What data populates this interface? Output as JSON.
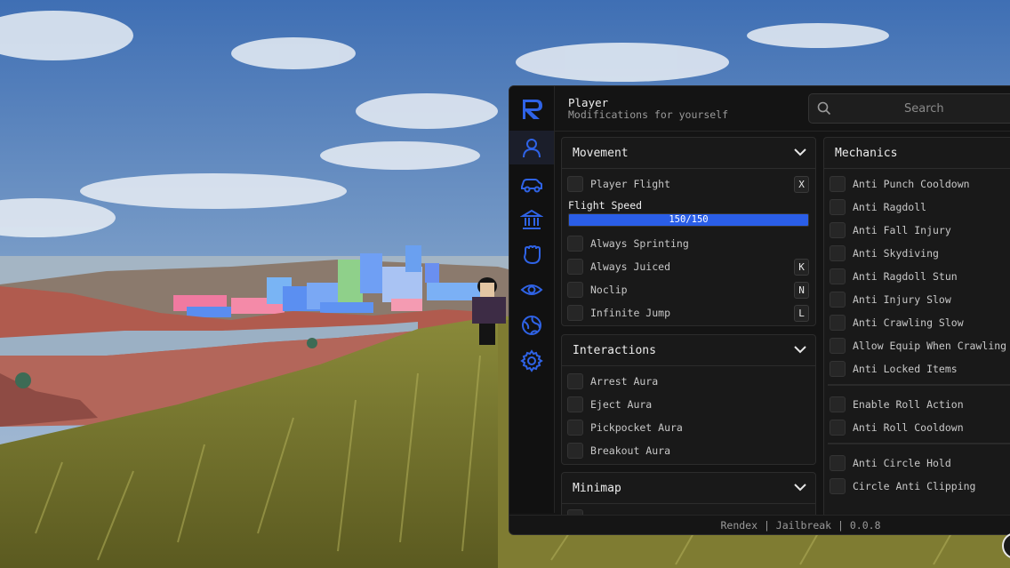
{
  "header": {
    "title": "Player",
    "subtitle": "Modifications for yourself"
  },
  "search": {
    "placeholder": "Search"
  },
  "sidebar": {
    "icons": [
      "logo-icon",
      "player-icon",
      "vehicle-icon",
      "bank-icon",
      "fist-icon",
      "eye-icon",
      "globe-icon",
      "gear-icon"
    ],
    "accent": "#2f63e6"
  },
  "movement": {
    "title": "Movement",
    "flight": {
      "label": "Player Flight",
      "key": "X"
    },
    "speed": {
      "label": "Flight Speed",
      "value": "150/150",
      "fraction": 1.0
    },
    "sprinting": {
      "label": "Always Sprinting"
    },
    "juiced": {
      "label": "Always Juiced",
      "key": "K"
    },
    "noclip": {
      "label": "Noclip",
      "key": "N"
    },
    "jump": {
      "label": "Infinite Jump",
      "key": "L"
    }
  },
  "interactions": {
    "title": "Interactions",
    "items": [
      "Arrest Aura",
      "Eject Aura",
      "Pickpocket Aura",
      "Breakout Aura"
    ]
  },
  "minimap": {
    "title": "Minimap"
  },
  "mechanics": {
    "title": "Mechanics",
    "group1": [
      "Anti Punch Cooldown",
      "Anti Ragdoll",
      "Anti Fall Injury",
      "Anti Skydiving",
      "Anti Ragdoll Stun",
      "Anti Injury Slow",
      "Anti Crawling Slow",
      "Allow Equip When Crawling",
      "Anti Locked Items"
    ],
    "group2": [
      "Enable Roll Action",
      "Anti Roll Cooldown"
    ],
    "group3": [
      "Anti Circle Hold",
      "Circle Anti Clipping"
    ]
  },
  "footer": {
    "text": "Rendex | Jailbreak | 0.0.8"
  }
}
